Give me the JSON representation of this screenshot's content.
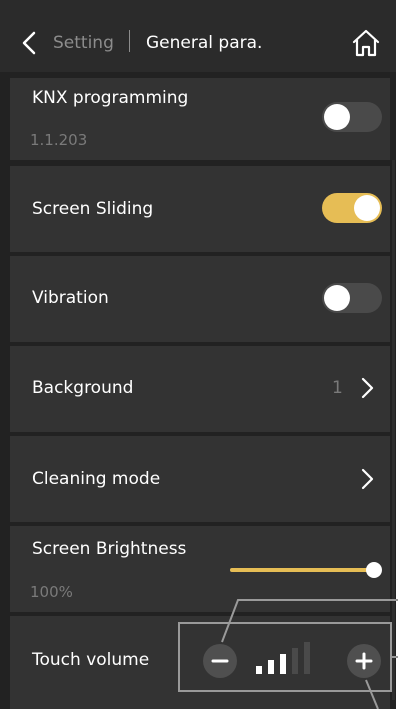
{
  "header": {
    "back_icon": "chevron-left-icon",
    "parent": "Setting",
    "title": "General para.",
    "home_icon": "home-icon"
  },
  "rows": {
    "knx": {
      "label": "KNX programming",
      "sub": "1.1.203",
      "toggle_on": false
    },
    "screen_sliding": {
      "label": "Screen Sliding",
      "toggle_on": true
    },
    "vibration": {
      "label": "Vibration",
      "toggle_on": false
    },
    "background": {
      "label": "Background",
      "value": "1"
    },
    "cleaning": {
      "label": "Cleaning mode"
    },
    "brightness": {
      "label": "Screen Brightness",
      "value_text": "100%",
      "level": 1.0
    },
    "touch_volume": {
      "label": "Touch volume",
      "level": 3,
      "max": 5
    }
  },
  "colors": {
    "accent": "#e6bd55",
    "background": "#222222",
    "row": "#333333",
    "text": "#ffffff",
    "muted": "#7a7a7a"
  }
}
